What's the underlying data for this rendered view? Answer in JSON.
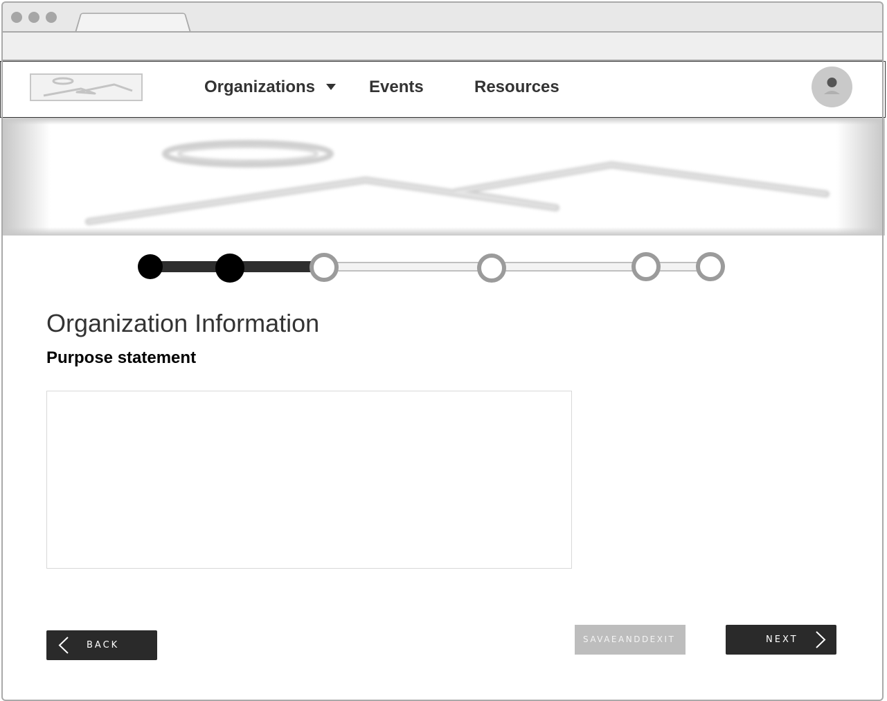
{
  "nav": {
    "items": [
      {
        "label": "Organizations",
        "has_dropdown": true
      },
      {
        "label": "Events"
      },
      {
        "label": "Resources"
      }
    ]
  },
  "stepper": {
    "total_steps": 6,
    "completed_steps": 2,
    "current_step": 2
  },
  "form": {
    "title": "Organization Information",
    "field_label": "Purpose statement",
    "field_value": "",
    "field_placeholder": ""
  },
  "buttons": {
    "back": "BACK",
    "save": "SAVAEANDDEXIT",
    "next": "NEXT"
  },
  "icons": {
    "logo": "image-placeholder-icon",
    "avatar": "user-avatar-icon",
    "hero": "image-placeholder-icon",
    "back": "chevron-left-icon",
    "next": "chevron-right-icon",
    "dropdown": "caret-down-icon"
  },
  "colors": {
    "primary_button": "#2a2a2a",
    "disabled_button": "#bdbdbd",
    "step_done": "#000000",
    "step_todo": "#9b9b9b"
  }
}
